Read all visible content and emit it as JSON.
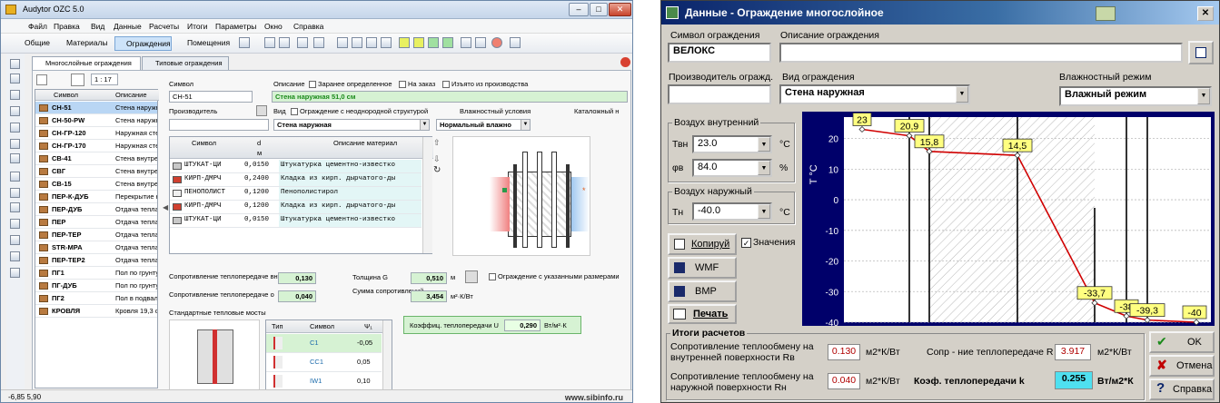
{
  "left": {
    "title": "Audytor OZC 5.0",
    "menu": [
      "Файл",
      "Правка",
      "Вид",
      "Данные",
      "Расчеты",
      "Итоги",
      "Параметры",
      "Окно",
      "Справка"
    ],
    "toolbar": {
      "general": "Общие",
      "materials": "Материалы",
      "partitions": "Ограждения",
      "rooms": "Помещения"
    },
    "tabs": {
      "multilayer": "Многослойные ограждения",
      "typical": "Типовые ограждения"
    },
    "scale": "1 : 17",
    "list": {
      "headers": {
        "symbol": "Символ",
        "description": "Описание"
      },
      "rows": [
        {
          "s": "СН-51",
          "d": "Стена наружная 51"
        },
        {
          "s": "СН-50-PW",
          "d": "Стена наружная 50"
        },
        {
          "s": "СН-ГР-120",
          "d": "Наружная стена,"
        },
        {
          "s": "СН-ГР-170",
          "d": "Наружная стена, п"
        },
        {
          "s": "СВ-41",
          "d": "Стена внутренняя"
        },
        {
          "s": "СВГ",
          "d": "Стена внутренняя"
        },
        {
          "s": "СВ-15",
          "d": "Стена внутренняя"
        },
        {
          "s": "ПЕР-К-ДУБ",
          "d": "Перекрытие наруж"
        },
        {
          "s": "ПЕР-ДУБ",
          "d": "Отдача тепла от ве"
        },
        {
          "s": "ПЕР",
          "d": "Отдача тепла от ве"
        },
        {
          "s": "ПЕР-ТЕР",
          "d": "Отдача тепла от ве"
        },
        {
          "s": "STR-MPA",
          "d": "Отдача тепла от ве"
        },
        {
          "s": "ПЕР-ТЕР2",
          "d": "Отдача тепла от ве"
        },
        {
          "s": "ПГ1",
          "d": "Пол по грунту 56,3"
        },
        {
          "s": "ПГ-ДУБ",
          "d": "Пол по грунту 56,3"
        },
        {
          "s": "ПГ2",
          "d": "Пол в подвале 56,3"
        },
        {
          "s": "КРОВЛЯ",
          "d": "Кровля 19,3 см"
        }
      ]
    },
    "form": {
      "symbol_label": "Символ",
      "symbol_value": "СН-51",
      "desc_label": "Описание",
      "desc_value": "Стена наружная 51,0 см",
      "chk_predefined": "Заранее определенное",
      "chk_order": "На заказ",
      "chk_removed": "Изъято из производства",
      "producer_label": "Производитель",
      "view_label": "Вид",
      "chk_nonuniform": "Ограждение с неоднородной структурой",
      "humidity_label": "Влажностный условия",
      "catalog_label": "Каталожный н",
      "view_value": "Стена наружная",
      "humidity_value": "Нормальный влажно"
    },
    "layers": {
      "headers": {
        "symbol": "Символ",
        "d": "d",
        "unit": "м",
        "desc": "Описание материал"
      },
      "rows": [
        {
          "s": "ШТУКАТ-ЦИ",
          "d": "0,0150",
          "m": "Штукатурка цементно-известко"
        },
        {
          "s": "КИРП-ДМРЧ",
          "d": "0,2400",
          "m": "Кладка из кирп. дырчатого-ды"
        },
        {
          "s": "ПЕНОПОЛИСТ",
          "d": "0,1200",
          "m": "Пенополистирол"
        },
        {
          "s": "КИРП-ДМРЧ",
          "d": "0,1200",
          "m": "Кладка из кирп. дырчатого-ды"
        },
        {
          "s": "ШТУКАТ-ЦИ",
          "d": "0,0150",
          "m": "Штукатурка цементно-известко"
        }
      ]
    },
    "summary": {
      "rsi_label": "Сопротивление теплопередаче внутри Ri",
      "rsi_value": "0,130",
      "rse_label": "Сопротивление теплопередаче о",
      "rse_value": "0,040",
      "thick_label": "Толщина G",
      "thick_value": "0,510",
      "thick_unit": "м",
      "sum_label": "Сумма сопротивлений",
      "sum_value": "3,454",
      "sum_unit": "м²·К/Вт",
      "chk_sized": "Ограждение с указанными размерами",
      "u_label": "Коэффиц. теплопередачи U",
      "u_value": "0,290",
      "u_unit": "Вт/м²·К"
    },
    "bridges": {
      "title": "Стандартные тепловые мосты",
      "headers": {
        "type": "Тип",
        "symbol": "Символ",
        "psi": "Ψ₁"
      },
      "rows": [
        {
          "s": "C1",
          "v": "-0,05"
        },
        {
          "s": "CC1",
          "v": "0,05"
        },
        {
          "s": "IW1",
          "v": "0,10"
        }
      ]
    },
    "status": "-6,85  5,90",
    "watermark": "www.sibinfo.ru"
  },
  "right": {
    "title": "Данные - Ограждение многослойное",
    "symbol_label": "Символ ограждения",
    "symbol_value": "ВЕЛОКС",
    "desc_label": "Описание ограждения",
    "desc_value": "",
    "producer_label": "Производитель огражд.",
    "producer_value": "",
    "view_label": "Вид ограждения",
    "view_value": "Стена наружная",
    "humidity_label": "Влажностный режим",
    "humidity_value": "Влажный режим",
    "air_in_label": "Воздух внутренний",
    "tvn_label": "Твн",
    "tvn_value": "23.0",
    "tvn_unit": "°С",
    "phi_label": "φв",
    "phi_value": "84.0",
    "phi_unit": "%",
    "air_out_label": "Воздух наружный",
    "tn_label": "Тн",
    "tn_value": "-40.0",
    "tn_unit": "°С",
    "btn_copy": "Копируй",
    "chk_values": "Значения",
    "btn_wmf": "WMF",
    "btn_bmp": "BMP",
    "btn_print": "Печать",
    "results_title": "Итоги расчетов",
    "rv_label": "Сопротивление теплообмену на внутренней поверхности Rв",
    "rv_value": "0.130",
    "rv_unit": "м2*К/Вт",
    "r_label": "Сопр - ние теплопередаче R",
    "r_value": "3.917",
    "r_unit": "м2*К/Вт",
    "rn_label": "Сопротивление теплообмену на наружной поверхности Rн",
    "rn_value": "0.040",
    "rn_unit": "м2*К/Вт",
    "k_label": "Коэф. теплопередачи k",
    "k_value": "0.255",
    "k_unit": "Вт/м2*К",
    "btn_ok": "OK",
    "btn_cancel": "Отмена",
    "btn_help": "Справка",
    "chart_data": {
      "type": "line",
      "ylabel": "T °C",
      "ylim": [
        -40,
        27
      ],
      "yticks": [
        20,
        10,
        0,
        -10,
        -20,
        -30,
        -40
      ],
      "colors": {
        "line": "#d00000",
        "bg": "#ffffff",
        "axis_bg": "#00006a"
      },
      "points": [
        {
          "label": "23",
          "y": 23
        },
        {
          "label": "20,9",
          "y": 20.9
        },
        {
          "label": "15,8",
          "y": 15.8
        },
        {
          "label": "14,5",
          "y": 14.5
        },
        {
          "label": "-33,7",
          "y": -33.7
        },
        {
          "label": "-38",
          "y": -38
        },
        {
          "label": "-39,3",
          "y": -39.3
        },
        {
          "label": "-40",
          "y": -40
        }
      ]
    }
  }
}
